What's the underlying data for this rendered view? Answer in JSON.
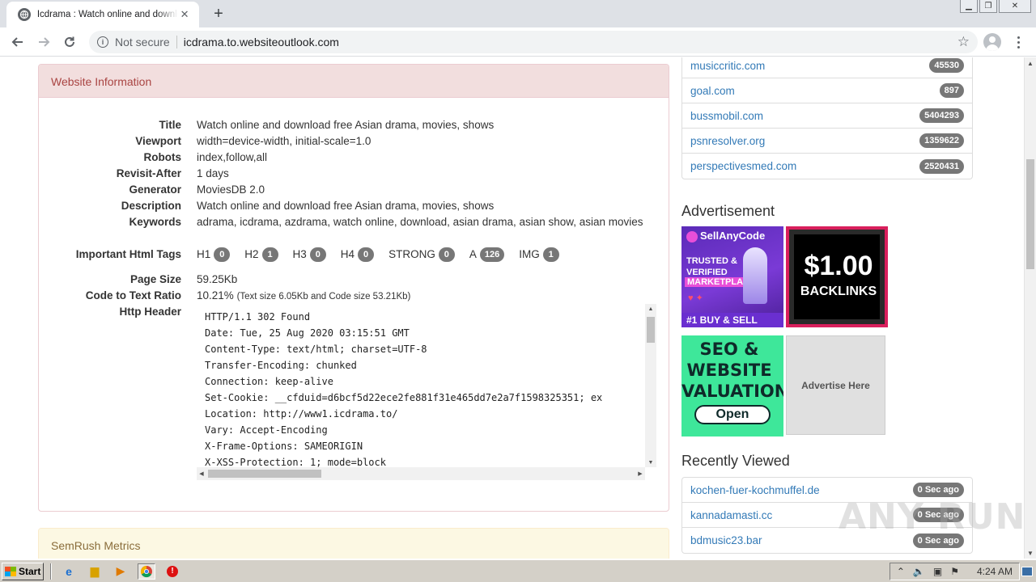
{
  "browser": {
    "tab_title": "Icdrama : Watch online and download free Asian drama, movies, shows",
    "security_label": "Not secure",
    "url": "icdrama.to.websiteoutlook.com"
  },
  "info_panel": {
    "heading": "Website Information",
    "rows": {
      "title": {
        "label": "Title",
        "value": "Watch online and download free Asian drama, movies, shows"
      },
      "viewport": {
        "label": "Viewport",
        "value": "width=device-width, initial-scale=1.0"
      },
      "robots": {
        "label": "Robots",
        "value": "index,follow,all"
      },
      "revisit": {
        "label": "Revisit-After",
        "value": "1 days"
      },
      "generator": {
        "label": "Generator",
        "value": "MoviesDB 2.0"
      },
      "description": {
        "label": "Description",
        "value": "Watch online and download free Asian drama, movies, shows"
      },
      "keywords": {
        "label": "Keywords",
        "value": "adrama, icdrama, azdrama, watch online, download, asian drama, asian show, asian movies"
      },
      "tags_label": "Important Html Tags",
      "page_size": {
        "label": "Page Size",
        "value": "59.25Kb"
      },
      "ratio": {
        "label": "Code to Text Ratio",
        "value": "10.21%",
        "detail": "(Text size 6.05Kb and Code size 53.21Kb)"
      },
      "http_header_label": "Http Header"
    },
    "tags": [
      {
        "name": "H1",
        "count": "0"
      },
      {
        "name": "H2",
        "count": "1"
      },
      {
        "name": "H3",
        "count": "0"
      },
      {
        "name": "H4",
        "count": "0"
      },
      {
        "name": "STRONG",
        "count": "0"
      },
      {
        "name": "A",
        "count": "126"
      },
      {
        "name": "IMG",
        "count": "1"
      }
    ],
    "http_header": [
      "HTTP/1.1 302 Found",
      "Date: Tue, 25 Aug 2020 03:15:51 GMT",
      "Content-Type: text/html; charset=UTF-8",
      "Transfer-Encoding: chunked",
      "Connection: keep-alive",
      "Set-Cookie: __cfduid=d6bcf5d22ece2fe881f31e465dd7e2a7f1598325351; ex",
      "Location: http://www1.icdrama.to/",
      "Vary: Accept-Encoding",
      "X-Frame-Options: SAMEORIGIN",
      "X-XSS-Protection: 1; mode=block"
    ]
  },
  "semrush": {
    "heading": "SemRush Metrics"
  },
  "top_sites": [
    {
      "name": "musiccritic.com",
      "rank": "45530"
    },
    {
      "name": "goal.com",
      "rank": "897"
    },
    {
      "name": "bussmobil.com",
      "rank": "5404293"
    },
    {
      "name": "psnresolver.org",
      "rank": "1359622"
    },
    {
      "name": "perspectivesmed.com",
      "rank": "2520431"
    }
  ],
  "advertisement": {
    "title": "Advertisement",
    "ad1": {
      "brand": "SellAnyCode",
      "line1": "TRUSTED &",
      "line2": "VERIFIED",
      "line3": "MARKETPLACE",
      "bottom": "#1 BUY & SELL"
    },
    "ad2": {
      "price": "$1.00",
      "word": "BACKLINKS"
    },
    "ad3": {
      "text": "SEO & WEBSITE VALUATION",
      "button": "Open"
    },
    "ad4": {
      "text": "Advertise Here"
    }
  },
  "recently_viewed": {
    "title": "Recently Viewed",
    "items": [
      {
        "name": "kochen-fuer-kochmuffel.de",
        "time": "0 Sec ago"
      },
      {
        "name": "kannadamasti.cc",
        "time": "0 Sec ago"
      },
      {
        "name": "bdmusic23.bar",
        "time": "0 Sec ago"
      }
    ]
  },
  "watermark": "ANY RUN",
  "taskbar": {
    "start": "Start",
    "clock": "4:24 AM"
  }
}
